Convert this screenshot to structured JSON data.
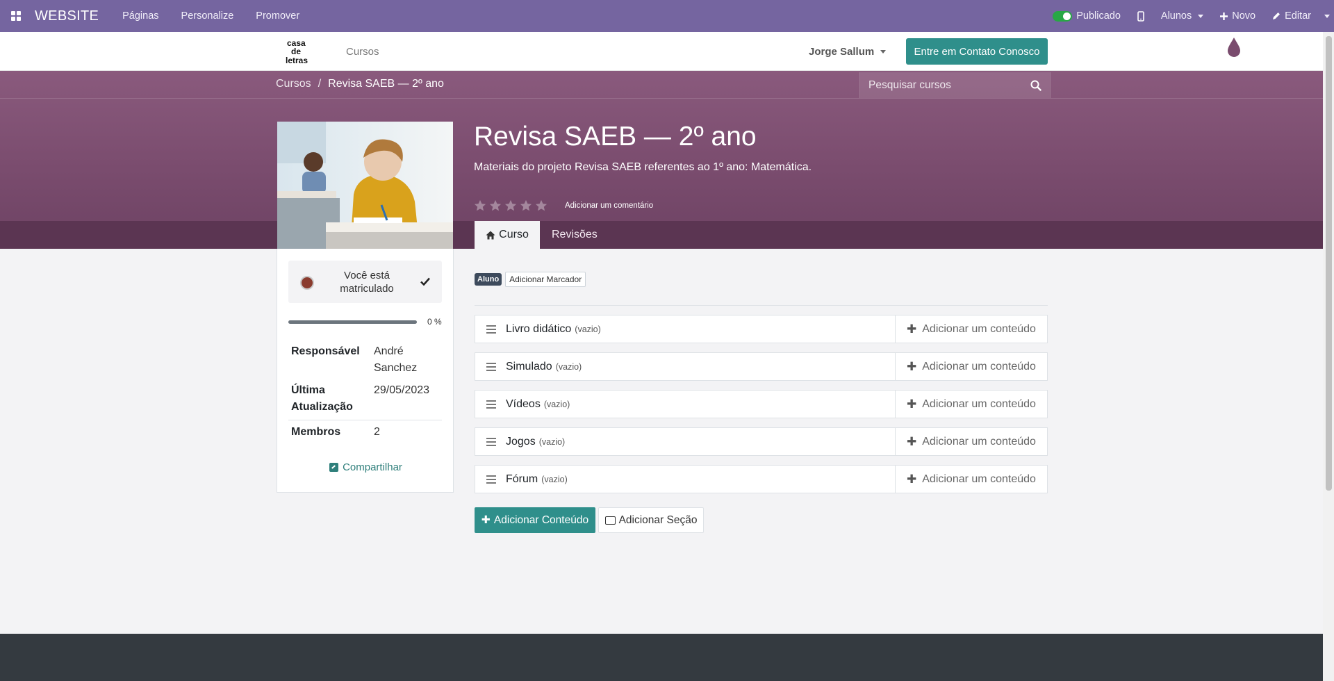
{
  "adminbar": {
    "brand": "WEBSITE",
    "menu": [
      "Páginas",
      "Personalize",
      "Promover"
    ],
    "published_label": "Publicado",
    "students_label": "Alunos",
    "new_label": "Novo",
    "edit_label": "Editar"
  },
  "header": {
    "nav_cursos": "Cursos",
    "user_name": "Jorge Sallum",
    "contact_button": "Entre em Contato Conosco",
    "accent_color": "#2f8f8b"
  },
  "breadcrumb": {
    "root": "Cursos",
    "separator": "/",
    "current": "Revisa SAEB — 2º ano"
  },
  "search": {
    "placeholder": "Pesquisar cursos"
  },
  "course": {
    "title": "Revisa SAEB — 2º ano",
    "description": "Materiais do projeto Revisa SAEB referentes ao 1º ano: Matemática.",
    "add_comment": "Adicionar um comentário",
    "rating_stars": 0
  },
  "tabs": {
    "curso": "Curso",
    "revisoes": "Revisões"
  },
  "sidebar": {
    "enrolled_text": "Você está matriculado",
    "progress_label": "0 %",
    "progress_value": 0,
    "info": [
      {
        "key": "Responsável",
        "value": "André Sanchez"
      },
      {
        "key": "Última Atualização",
        "value": "29/05/2023"
      },
      {
        "key": "Membros",
        "value": "2"
      }
    ],
    "share": "Compartilhar"
  },
  "tags": {
    "badge": "Aluno",
    "add_tag": "Adicionar Marcador"
  },
  "sections": [
    {
      "name": "Livro didático",
      "empty": "(vazio)",
      "add": "Adicionar um conteúdo"
    },
    {
      "name": "Simulado",
      "empty": "(vazio)",
      "add": "Adicionar um conteúdo"
    },
    {
      "name": "Vídeos",
      "empty": "(vazio)",
      "add": "Adicionar um conteúdo"
    },
    {
      "name": "Jogos",
      "empty": "(vazio)",
      "add": "Adicionar um conteúdo"
    },
    {
      "name": "Fórum",
      "empty": "(vazio)",
      "add": "Adicionar um conteúdo"
    }
  ],
  "actions": {
    "add_content": "Adicionar Conteúdo",
    "add_section": "Adicionar Seção"
  }
}
